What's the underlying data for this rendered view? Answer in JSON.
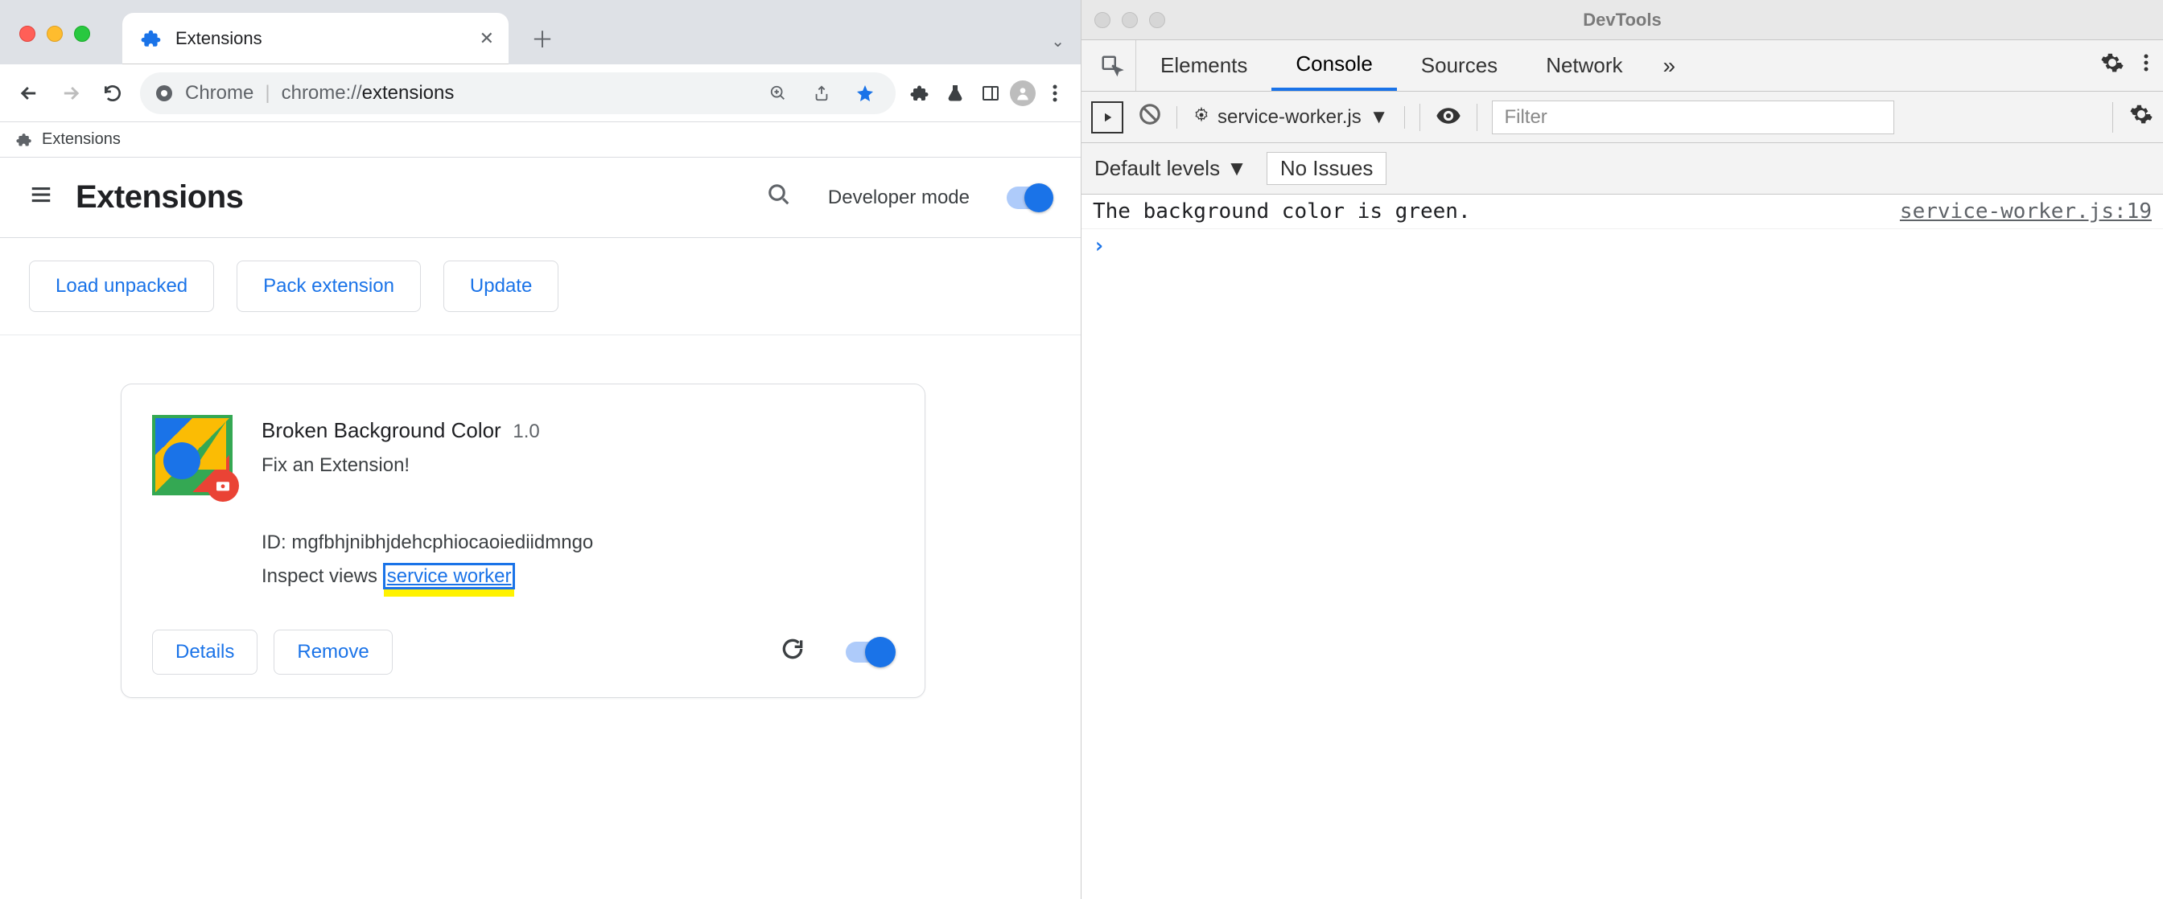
{
  "chrome": {
    "tab": {
      "title": "Extensions"
    },
    "omnibox": {
      "scheme_label": "Chrome",
      "url_scheme": "chrome://",
      "url_bold": "extensions"
    },
    "bookmark": {
      "label": "Extensions"
    },
    "header": {
      "title": "Extensions",
      "dev_mode_label": "Developer mode"
    },
    "actions": {
      "load_unpacked": "Load unpacked",
      "pack_extension": "Pack extension",
      "update": "Update"
    },
    "extension": {
      "name": "Broken Background Color",
      "version": "1.0",
      "description": "Fix an Extension!",
      "id_label": "ID:",
      "id_value": "mgfbhjnibhjdehcphiocaoiediidmngo",
      "inspect_label": "Inspect views",
      "inspect_link": "service worker",
      "details_btn": "Details",
      "remove_btn": "Remove"
    }
  },
  "devtools": {
    "title": "DevTools",
    "tabs": {
      "elements": "Elements",
      "console": "Console",
      "sources": "Sources",
      "network": "Network"
    },
    "context": "service-worker.js",
    "filter_placeholder": "Filter",
    "levels_label": "Default levels",
    "issues_label": "No Issues",
    "log": {
      "message": "The background color is green.",
      "source": "service-worker.js:19"
    }
  }
}
